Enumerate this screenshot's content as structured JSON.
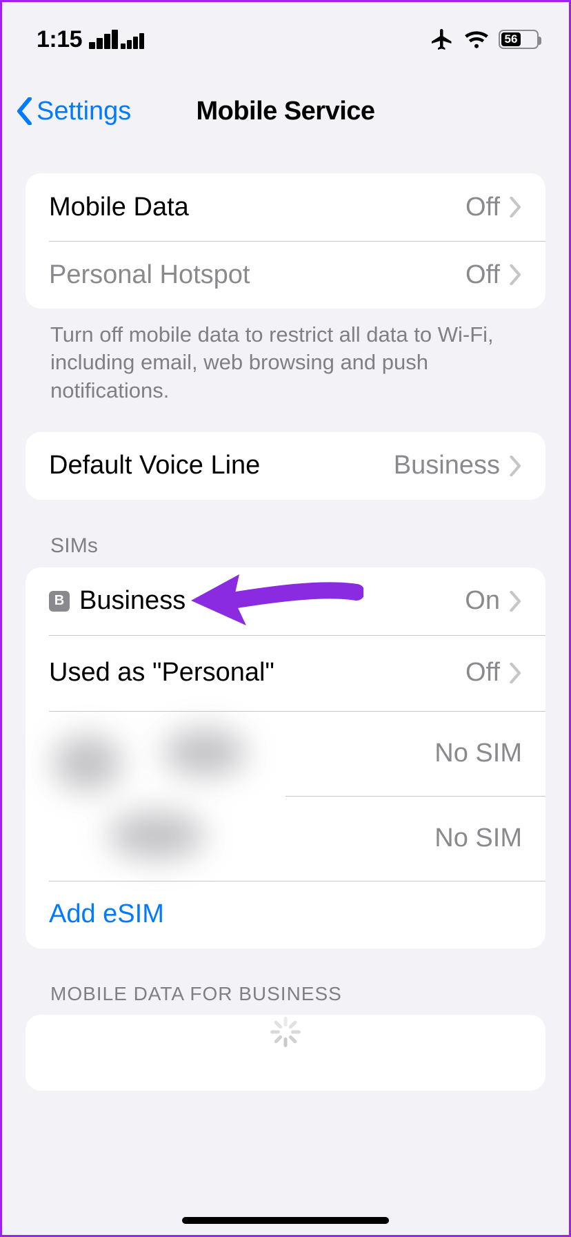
{
  "status": {
    "time": "1:15",
    "battery_pct": 56
  },
  "nav": {
    "back_label": "Settings",
    "title": "Mobile Service"
  },
  "group1": {
    "mobile_data": {
      "label": "Mobile Data",
      "value": "Off"
    },
    "hotspot": {
      "label": "Personal Hotspot",
      "value": "Off"
    },
    "footer": "Turn off mobile data to restrict all data to Wi-Fi, including email, web browsing and push notifications."
  },
  "group2": {
    "voice_line": {
      "label": "Default Voice Line",
      "value": "Business"
    }
  },
  "sims": {
    "header": "SIMs",
    "business": {
      "badge": "B",
      "label": "Business",
      "value": "On"
    },
    "personal": {
      "label": "Used as \"Personal\"",
      "value": "Off"
    },
    "nosim": "No SIM",
    "add_esim": "Add eSIM"
  },
  "mobile_data_section": {
    "header": "MOBILE DATA FOR BUSINESS"
  }
}
